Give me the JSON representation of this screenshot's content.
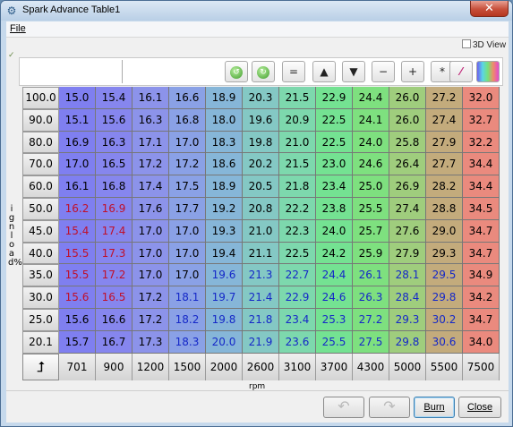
{
  "window": {
    "title": "Spark Advance Table1"
  },
  "menu": {
    "file": "File"
  },
  "view3d_label": "3D View",
  "toolbar": {
    "buttons": [
      {
        "name": "rotate-left-icon",
        "glyph": "↺"
      },
      {
        "name": "rotate-right-icon",
        "glyph": "↻"
      },
      {
        "name": "set-equal-button",
        "glyph": "="
      },
      {
        "name": "increment-button",
        "glyph": "▲"
      },
      {
        "name": "decrement-button",
        "glyph": "▼"
      },
      {
        "name": "subtract-button",
        "glyph": "−"
      },
      {
        "name": "add-button",
        "glyph": "+"
      },
      {
        "name": "multiply-button",
        "glyph": "*"
      },
      {
        "name": "interpolate-button",
        "glyph": "⁄"
      },
      {
        "name": "color-map-button",
        "glyph": "▮"
      }
    ]
  },
  "y_axis_label": "ignload%",
  "x_axis_label": "rpm",
  "rows": [
    "100.0",
    "90.0",
    "80.0",
    "70.0",
    "60.0",
    "50.0",
    "45.0",
    "40.0",
    "35.0",
    "30.0",
    "25.0",
    "20.1"
  ],
  "cols": [
    "701",
    "900",
    "1200",
    "1500",
    "2000",
    "2600",
    "3100",
    "3700",
    "4300",
    "5000",
    "5500",
    "7500"
  ],
  "cells": [
    [
      "15.0",
      "15.4",
      "16.1",
      "16.6",
      "18.9",
      "20.3",
      "21.5",
      "22.9",
      "24.4",
      "26.0",
      "27.2",
      "32.0"
    ],
    [
      "15.1",
      "15.6",
      "16.3",
      "16.8",
      "18.0",
      "19.6",
      "20.9",
      "22.5",
      "24.1",
      "26.0",
      "27.4",
      "32.7"
    ],
    [
      "16.9",
      "16.3",
      "17.1",
      "17.0",
      "18.3",
      "19.8",
      "21.0",
      "22.5",
      "24.0",
      "25.8",
      "27.9",
      "32.2"
    ],
    [
      "17.0",
      "16.5",
      "17.2",
      "17.2",
      "18.6",
      "20.2",
      "21.5",
      "23.0",
      "24.6",
      "26.4",
      "27.7",
      "34.4"
    ],
    [
      "16.1",
      "16.8",
      "17.4",
      "17.5",
      "18.9",
      "20.5",
      "21.8",
      "23.4",
      "25.0",
      "26.9",
      "28.2",
      "34.4"
    ],
    [
      "16.2",
      "16.9",
      "17.6",
      "17.7",
      "19.2",
      "20.8",
      "22.2",
      "23.8",
      "25.5",
      "27.4",
      "28.8",
      "34.5"
    ],
    [
      "15.4",
      "17.4",
      "17.0",
      "17.0",
      "19.3",
      "21.0",
      "22.3",
      "24.0",
      "25.7",
      "27.6",
      "29.0",
      "34.7"
    ],
    [
      "15.5",
      "17.3",
      "17.0",
      "17.0",
      "19.4",
      "21.1",
      "22.5",
      "24.2",
      "25.9",
      "27.9",
      "29.3",
      "34.7"
    ],
    [
      "15.5",
      "17.2",
      "17.0",
      "17.0",
      "19.6",
      "21.3",
      "22.7",
      "24.4",
      "26.1",
      "28.1",
      "29.5",
      "34.9"
    ],
    [
      "15.6",
      "16.5",
      "17.2",
      "18.1",
      "19.7",
      "21.4",
      "22.9",
      "24.6",
      "26.3",
      "28.4",
      "29.8",
      "34.2"
    ],
    [
      "15.6",
      "16.6",
      "17.2",
      "18.2",
      "19.8",
      "21.8",
      "23.4",
      "25.3",
      "27.2",
      "29.3",
      "30.2",
      "34.7"
    ],
    [
      "15.7",
      "16.7",
      "17.3",
      "18.3",
      "20.0",
      "21.9",
      "23.6",
      "25.5",
      "27.5",
      "29.8",
      "30.6",
      "34.0"
    ]
  ],
  "text_colors": {
    "default": "#000000",
    "red": "#c0102a",
    "blue": "#1528c8"
  },
  "cell_text_color_map": [
    "kkkkkkkkkkkk",
    "kkkkkkkkkkkk",
    "kkkkkkkkkkkk",
    "kkkkkkkkkkkk",
    "kkkkkkkkkkkk",
    "rrkkkkkkkkkk",
    "rrkkkkkkkkkk",
    "rrkkkkkkkkkk",
    "rrkkbbbbbbbk",
    "rrkbbbbbbbbk",
    "kkkbbbbbbbbk",
    "kkkbbbbbbbbk"
  ],
  "column_colors": [
    "#7f7ff0",
    "#8686ee",
    "#8c93ea",
    "#8aa1e6",
    "#86b6d8",
    "#84c8c4",
    "#7dd8ad",
    "#74e292",
    "#7ee07f",
    "#9fcd7d",
    "#c3ab7c",
    "#ea8a7e"
  ],
  "buttons": {
    "burn": "Burn",
    "close": "Close"
  }
}
